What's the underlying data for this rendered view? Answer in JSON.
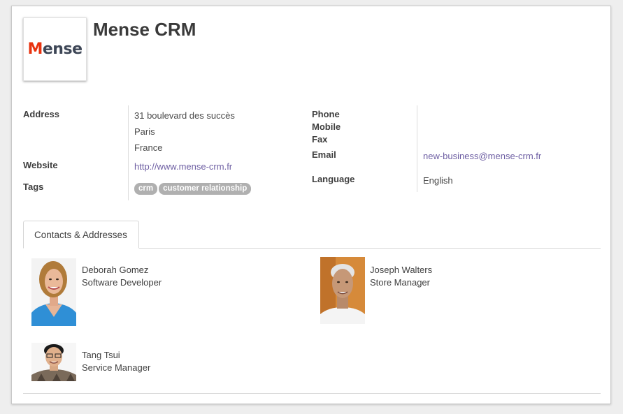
{
  "company": {
    "logo_text_first": "M",
    "logo_text_rest": "ense",
    "name": "Mense CRM"
  },
  "left_fields": {
    "address_label": "Address",
    "address_line1": "31 boulevard des succès",
    "address_city": "Paris",
    "address_country": "France",
    "website_label": "Website",
    "website_value": "http://www.mense-crm.fr",
    "tags_label": "Tags",
    "tags": [
      "crm",
      "customer relationship"
    ]
  },
  "right_fields": {
    "phone_label": "Phone",
    "mobile_label": "Mobile",
    "fax_label": "Fax",
    "email_label": "Email",
    "email_value": "new-business@mense-crm.fr",
    "language_label": "Language",
    "language_value": "English"
  },
  "tabs": [
    {
      "label": "Contacts & Addresses"
    }
  ],
  "contacts": [
    {
      "name": "Deborah Gomez",
      "role": "Software Developer"
    },
    {
      "name": "Joseph Walters",
      "role": "Store Manager"
    },
    {
      "name": "Tang Tsui",
      "role": "Service Manager"
    }
  ],
  "colors": {
    "link": "#6e5fa3",
    "tag_bg": "#b0b0b0",
    "logo_accent": "#e8330f",
    "logo_dark": "#3d4656"
  }
}
